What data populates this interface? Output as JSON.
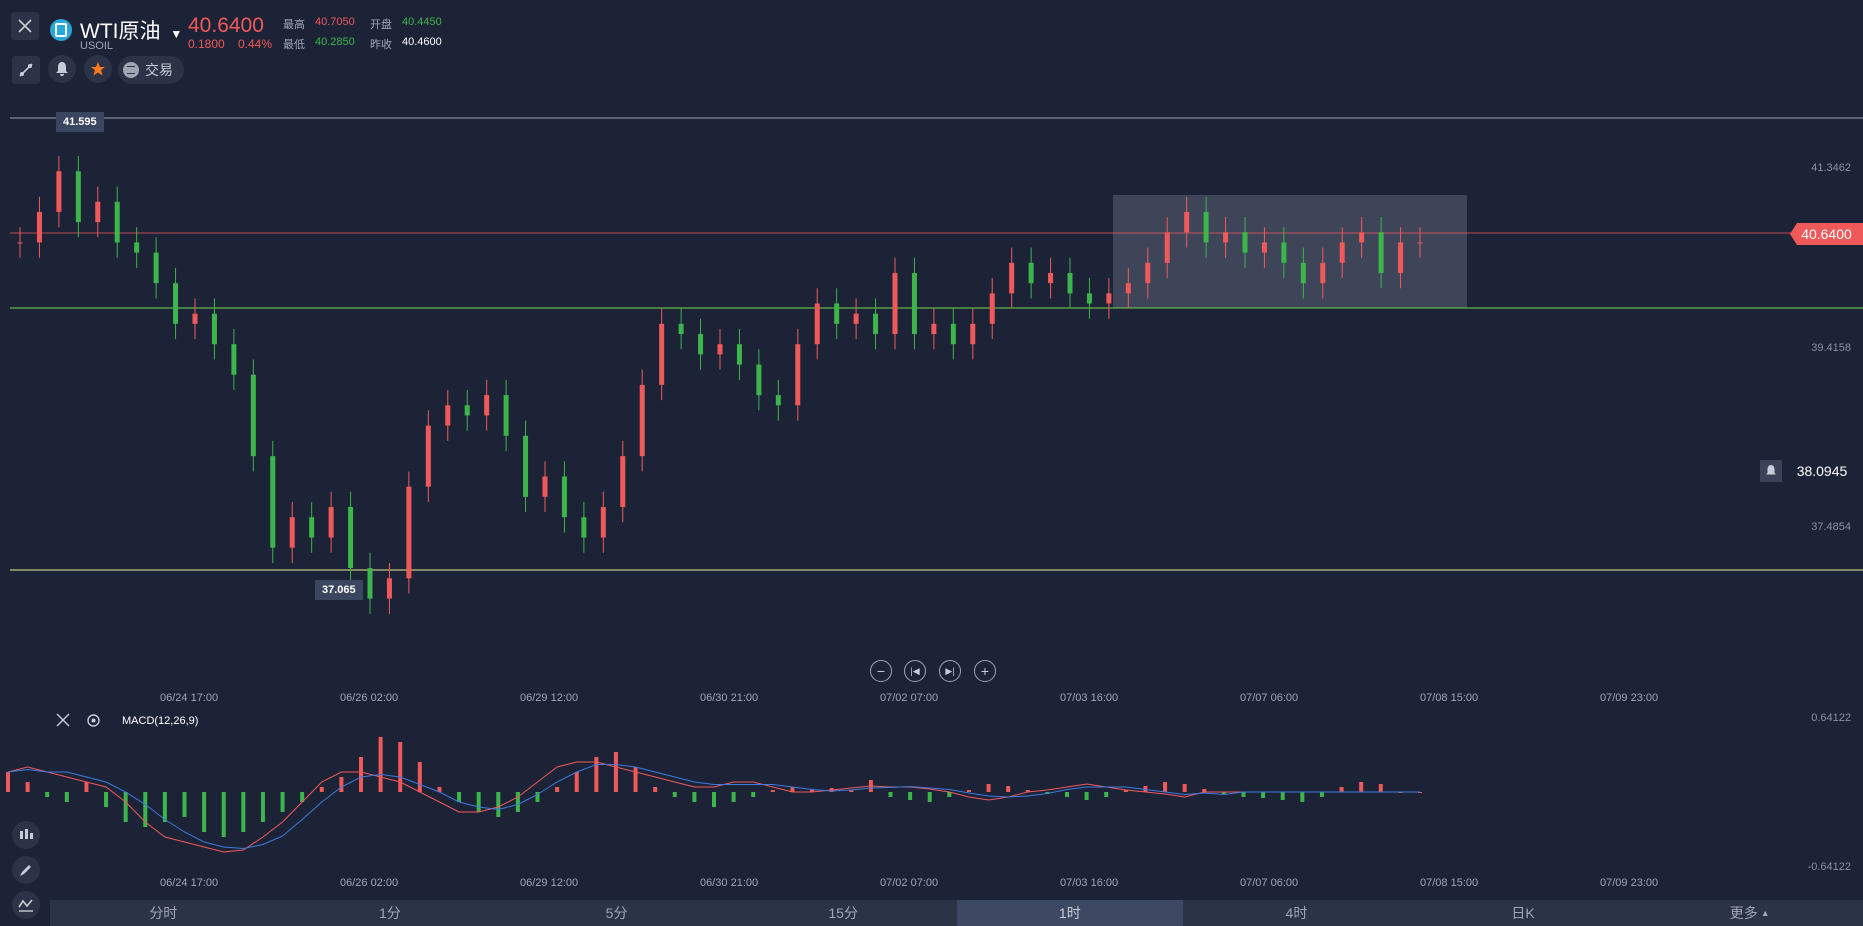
{
  "header": {
    "title": "WTI原油",
    "symbol": "USOIL",
    "price": "40.6400",
    "change": "0.1800",
    "change_pct": "0.44%",
    "high_label": "最高",
    "high_value": "40.7050",
    "open_label": "开盘",
    "open_value": "40.4450",
    "low_label": "最低",
    "low_value": "40.2850",
    "prev_label": "昨收",
    "prev_value": "40.4600"
  },
  "toolbar": {
    "trade_label": "交易"
  },
  "y_axis": [
    "41.3462",
    "39.4158",
    "37.4854"
  ],
  "current_price_tag": "40.6400",
  "alert_value": "38.0945",
  "high_marker": "41.595",
  "low_marker": "37.065",
  "time_ticks": [
    "06/24 17:00",
    "06/26 02:00",
    "06/29 12:00",
    "06/30 21:00",
    "07/02 07:00",
    "07/03 16:00",
    "07/07 06:00",
    "07/08 15:00",
    "07/09 23:00"
  ],
  "macd": {
    "label": "MACD(12,26,9)",
    "top": "0.64122",
    "bottom": "-0.64122"
  },
  "tabs": [
    "分时",
    "1分",
    "5分",
    "15分",
    "1时",
    "4时",
    "日K",
    "更多"
  ],
  "active_tab": "1时",
  "colors": {
    "up": "#f0595a",
    "down": "#3cb54a",
    "bg": "#1d2336",
    "accent": "#2aa7d9"
  },
  "chart_data": {
    "type": "candlestick",
    "y_range": [
      36.3,
      42.0
    ],
    "closes": [
      40.6,
      40.9,
      41.3,
      40.8,
      41.0,
      40.6,
      40.5,
      40.2,
      39.8,
      39.9,
      39.6,
      39.3,
      38.5,
      37.6,
      37.9,
      37.7,
      38.0,
      37.4,
      37.1,
      37.3,
      38.2,
      38.8,
      39.0,
      38.9,
      39.1,
      38.7,
      38.1,
      38.3,
      37.9,
      37.7,
      38.0,
      38.5,
      39.2,
      39.8,
      39.7,
      39.5,
      39.6,
      39.4,
      39.1,
      39.0,
      39.6,
      40.0,
      39.8,
      39.9,
      39.7,
      40.3,
      39.7,
      39.8,
      39.6,
      39.8,
      40.1,
      40.4,
      40.2,
      40.3,
      40.1,
      40.0,
      40.1,
      40.2,
      40.4,
      40.7,
      40.9,
      40.6,
      40.7,
      40.5,
      40.6,
      40.4,
      40.2,
      40.4,
      40.6,
      40.7,
      40.3,
      40.6,
      40.6
    ],
    "macd_hist": [
      0.2,
      0.1,
      -0.05,
      -0.1,
      0.1,
      -0.15,
      -0.3,
      -0.35,
      -0.3,
      -0.25,
      -0.4,
      -0.45,
      -0.4,
      -0.3,
      -0.2,
      -0.1,
      0.05,
      0.15,
      0.35,
      0.55,
      0.5,
      0.3,
      0.05,
      -0.1,
      -0.2,
      -0.25,
      -0.2,
      -0.1,
      0.05,
      0.2,
      0.35,
      0.4,
      0.25,
      0.05,
      -0.05,
      -0.1,
      -0.15,
      -0.1,
      -0.05,
      0.02,
      0.05,
      0.03,
      0.04,
      0.02,
      0.12,
      -0.05,
      -0.08,
      -0.1,
      -0.05,
      0.02,
      0.08,
      0.06,
      0.02,
      -0.02,
      -0.05,
      -0.08,
      -0.05,
      0.02,
      0.06,
      0.1,
      0.08,
      0.03,
      -0.02,
      -0.05,
      -0.06,
      -0.08,
      -0.1,
      -0.05,
      0.05,
      0.1,
      0.08,
      0.0,
      0.0
    ],
    "macd_line": [
      0.2,
      0.25,
      0.2,
      0.15,
      0.1,
      0.05,
      -0.1,
      -0.3,
      -0.45,
      -0.5,
      -0.55,
      -0.6,
      -0.58,
      -0.45,
      -0.3,
      -0.1,
      0.1,
      0.2,
      0.2,
      0.15,
      0.1,
      0.0,
      -0.1,
      -0.2,
      -0.2,
      -0.15,
      -0.05,
      0.1,
      0.25,
      0.3,
      0.3,
      0.25,
      0.2,
      0.15,
      0.1,
      0.05,
      0.05,
      0.1,
      0.1,
      0.05,
      0.0,
      0.0,
      0.02,
      0.04,
      0.06,
      0.05,
      0.05,
      0.03,
      0.0,
      -0.05,
      -0.08,
      -0.05,
      0.0,
      0.02,
      0.05,
      0.08,
      0.05,
      0.02,
      0.0,
      -0.02,
      -0.05,
      0.0,
      0.0,
      0.0,
      0.0,
      0.0,
      0.0,
      0.0,
      0.0,
      0.0,
      0.0,
      0.0,
      0.0
    ]
  }
}
